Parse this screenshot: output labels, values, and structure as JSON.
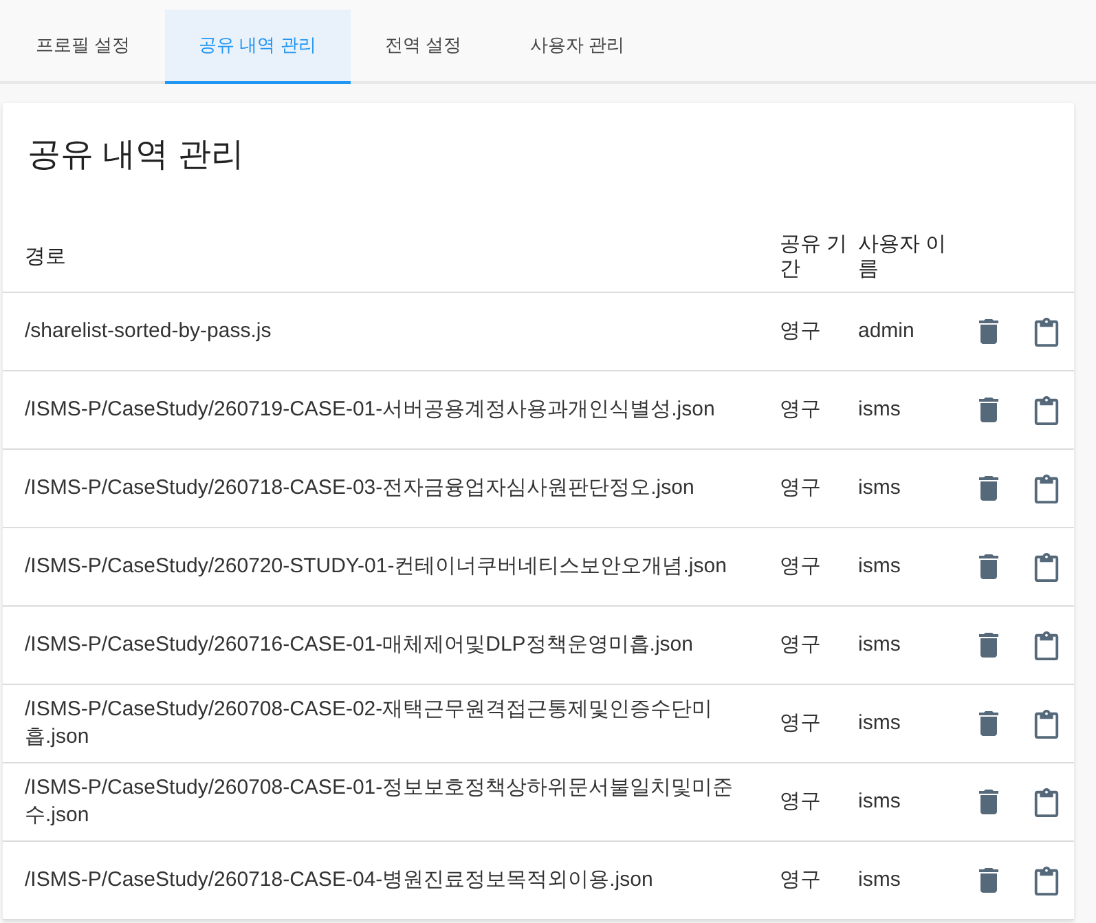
{
  "tabs": [
    {
      "label": "프로필 설정",
      "selected": false
    },
    {
      "label": "공유 내역 관리",
      "selected": true
    },
    {
      "label": "전역 설정",
      "selected": false
    },
    {
      "label": "사용자 관리",
      "selected": false
    }
  ],
  "panel": {
    "title": "공유 내역 관리"
  },
  "table": {
    "columns": [
      "경로",
      "공유 기간",
      "사용자 이름"
    ],
    "rows": [
      {
        "path": "/sharelist-sorted-by-pass.js",
        "period": "영구",
        "user": "admin"
      },
      {
        "path": "/ISMS-P/CaseStudy/260719-CASE-01-서버공용계정사용과개인식별성.json",
        "period": "영구",
        "user": "isms"
      },
      {
        "path": "/ISMS-P/CaseStudy/260718-CASE-03-전자금융업자심사원판단정오.json",
        "period": "영구",
        "user": "isms"
      },
      {
        "path": "/ISMS-P/CaseStudy/260720-STUDY-01-컨테이너쿠버네티스보안오개념.json",
        "period": "영구",
        "user": "isms"
      },
      {
        "path": "/ISMS-P/CaseStudy/260716-CASE-01-매체제어및DLP정책운영미흡.json",
        "period": "영구",
        "user": "isms"
      },
      {
        "path": "/ISMS-P/CaseStudy/260708-CASE-02-재택근무원격접근통제및인증수단미흡.json",
        "period": "영구",
        "user": "isms"
      },
      {
        "path": "/ISMS-P/CaseStudy/260708-CASE-01-정보보호정책상하위문서불일치및미준수.json",
        "period": "영구",
        "user": "isms"
      },
      {
        "path": "/ISMS-P/CaseStudy/260718-CASE-04-병원진료정보목적외이용.json",
        "period": "영구",
        "user": "isms"
      }
    ]
  }
}
